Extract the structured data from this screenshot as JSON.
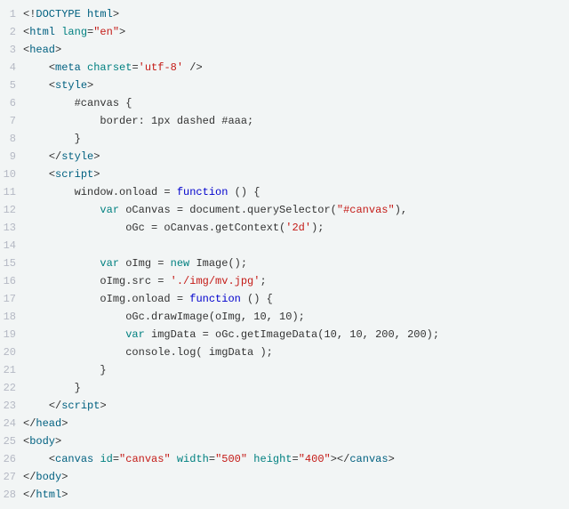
{
  "code": {
    "lines": [
      {
        "n": 1,
        "indent": "",
        "tokens": [
          [
            "plain",
            "<!"
          ],
          [
            "tag",
            "DOCTYPE html"
          ],
          [
            "plain",
            ">"
          ]
        ]
      },
      {
        "n": 2,
        "indent": "",
        "tokens": [
          [
            "plain",
            "<"
          ],
          [
            "tag",
            "html"
          ],
          [
            "plain",
            " "
          ],
          [
            "attr",
            "lang"
          ],
          [
            "plain",
            "="
          ],
          [
            "str",
            "\"en\""
          ],
          [
            "plain",
            ">"
          ]
        ]
      },
      {
        "n": 3,
        "indent": "",
        "tokens": [
          [
            "plain",
            "<"
          ],
          [
            "tag",
            "head"
          ],
          [
            "plain",
            ">"
          ]
        ]
      },
      {
        "n": 4,
        "indent": "    ",
        "tokens": [
          [
            "plain",
            "<"
          ],
          [
            "tag",
            "meta"
          ],
          [
            "plain",
            " "
          ],
          [
            "attr",
            "charset"
          ],
          [
            "plain",
            "="
          ],
          [
            "str",
            "'utf-8'"
          ],
          [
            "plain",
            " />"
          ]
        ]
      },
      {
        "n": 5,
        "indent": "    ",
        "tokens": [
          [
            "plain",
            "<"
          ],
          [
            "tag",
            "style"
          ],
          [
            "plain",
            ">"
          ]
        ]
      },
      {
        "n": 6,
        "indent": "        ",
        "tokens": [
          [
            "plain",
            "#canvas {"
          ]
        ]
      },
      {
        "n": 7,
        "indent": "            ",
        "tokens": [
          [
            "plain",
            "border: 1px dashed #aaa;"
          ]
        ]
      },
      {
        "n": 8,
        "indent": "        ",
        "tokens": [
          [
            "plain",
            "}"
          ]
        ]
      },
      {
        "n": 9,
        "indent": "    ",
        "tokens": [
          [
            "plain",
            "</"
          ],
          [
            "tag",
            "style"
          ],
          [
            "plain",
            ">"
          ]
        ]
      },
      {
        "n": 10,
        "indent": "    ",
        "tokens": [
          [
            "plain",
            "<"
          ],
          [
            "tag",
            "script"
          ],
          [
            "plain",
            ">"
          ]
        ]
      },
      {
        "n": 11,
        "indent": "        ",
        "tokens": [
          [
            "plain",
            "window.onload = "
          ],
          [
            "fnkw",
            "function"
          ],
          [
            "plain",
            " () {"
          ]
        ]
      },
      {
        "n": 12,
        "indent": "            ",
        "tokens": [
          [
            "kw",
            "var"
          ],
          [
            "plain",
            " oCanvas = document.querySelector("
          ],
          [
            "str",
            "\"#canvas\""
          ],
          [
            "plain",
            "),"
          ]
        ]
      },
      {
        "n": 13,
        "indent": "                ",
        "tokens": [
          [
            "plain",
            "oGc = oCanvas.getContext("
          ],
          [
            "str",
            "'2d'"
          ],
          [
            "plain",
            ");"
          ]
        ]
      },
      {
        "n": 14,
        "indent": "",
        "tokens": []
      },
      {
        "n": 15,
        "indent": "            ",
        "tokens": [
          [
            "kw",
            "var"
          ],
          [
            "plain",
            " oImg = "
          ],
          [
            "kw",
            "new"
          ],
          [
            "plain",
            " Image();"
          ]
        ]
      },
      {
        "n": 16,
        "indent": "            ",
        "tokens": [
          [
            "plain",
            "oImg.src = "
          ],
          [
            "str",
            "'./img/mv.jpg'"
          ],
          [
            "plain",
            ";"
          ]
        ]
      },
      {
        "n": 17,
        "indent": "            ",
        "tokens": [
          [
            "plain",
            "oImg.onload = "
          ],
          [
            "fnkw",
            "function"
          ],
          [
            "plain",
            " () {"
          ]
        ]
      },
      {
        "n": 18,
        "indent": "                ",
        "tokens": [
          [
            "plain",
            "oGc.drawImage(oImg, 10, 10);"
          ]
        ]
      },
      {
        "n": 19,
        "indent": "                ",
        "tokens": [
          [
            "kw",
            "var"
          ],
          [
            "plain",
            " imgData = oGc.getImageData(10, 10, 200, 200);"
          ]
        ]
      },
      {
        "n": 20,
        "indent": "                ",
        "tokens": [
          [
            "plain",
            "console.log( imgData );"
          ]
        ]
      },
      {
        "n": 21,
        "indent": "            ",
        "tokens": [
          [
            "plain",
            "}"
          ]
        ]
      },
      {
        "n": 22,
        "indent": "        ",
        "tokens": [
          [
            "plain",
            "}"
          ]
        ]
      },
      {
        "n": 23,
        "indent": "    ",
        "tokens": [
          [
            "plain",
            "</"
          ],
          [
            "tag",
            "script"
          ],
          [
            "plain",
            ">"
          ]
        ]
      },
      {
        "n": 24,
        "indent": "",
        "tokens": [
          [
            "plain",
            "</"
          ],
          [
            "tag",
            "head"
          ],
          [
            "plain",
            ">"
          ]
        ]
      },
      {
        "n": 25,
        "indent": "",
        "tokens": [
          [
            "plain",
            "<"
          ],
          [
            "tag",
            "body"
          ],
          [
            "plain",
            ">"
          ]
        ]
      },
      {
        "n": 26,
        "indent": "    ",
        "tokens": [
          [
            "plain",
            "<"
          ],
          [
            "tag",
            "canvas"
          ],
          [
            "plain",
            " "
          ],
          [
            "attr",
            "id"
          ],
          [
            "plain",
            "="
          ],
          [
            "str",
            "\"canvas\""
          ],
          [
            "plain",
            " "
          ],
          [
            "attr",
            "width"
          ],
          [
            "plain",
            "="
          ],
          [
            "str",
            "\"500\""
          ],
          [
            "plain",
            " "
          ],
          [
            "attr",
            "height"
          ],
          [
            "plain",
            "="
          ],
          [
            "str",
            "\"400\""
          ],
          [
            "plain",
            "></"
          ],
          [
            "tag",
            "canvas"
          ],
          [
            "plain",
            ">"
          ]
        ]
      },
      {
        "n": 27,
        "indent": "",
        "tokens": [
          [
            "plain",
            "</"
          ],
          [
            "tag",
            "body"
          ],
          [
            "plain",
            ">"
          ]
        ]
      },
      {
        "n": 28,
        "indent": "",
        "tokens": [
          [
            "plain",
            "</"
          ],
          [
            "tag",
            "html"
          ],
          [
            "plain",
            ">"
          ]
        ]
      }
    ]
  }
}
